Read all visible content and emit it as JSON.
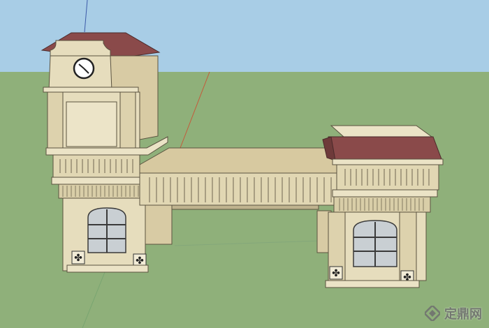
{
  "viewport": {
    "sky_color": "#a8cde6",
    "ground_color": "#8fb07a",
    "wall_color": "#e6ddbd",
    "wall_shadow_color": "#cbbf9a",
    "roof_color": "#8a4a4a",
    "window_glass_color": "#c9cfd3",
    "axis_red": "#c45a3a",
    "axis_blue": "#3c5aa8",
    "axis_green": "#4a8a4a"
  },
  "watermark": {
    "text": "定鼎网",
    "logo_icon": "dingding-logo-icon"
  }
}
